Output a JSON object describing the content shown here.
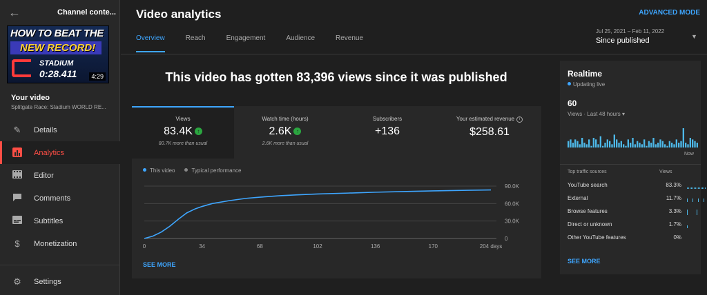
{
  "sidebar": {
    "title": "Channel conte...",
    "thumbnail": {
      "line1": "HOW TO BEAT THE",
      "line2": "NEW RECORD!",
      "line3": "STADIUM",
      "line4": "0:28.411",
      "duration": "4:29"
    },
    "your_video_label": "Your video",
    "video_title": "Splitgate Race: Stadium WORLD RE...",
    "nav": [
      {
        "label": "Details",
        "icon": "pencil-icon",
        "active": false
      },
      {
        "label": "Analytics",
        "icon": "analytics-icon",
        "active": true
      },
      {
        "label": "Editor",
        "icon": "film-icon",
        "active": false
      },
      {
        "label": "Comments",
        "icon": "comment-icon",
        "active": false
      },
      {
        "label": "Subtitles",
        "icon": "subtitles-icon",
        "active": false
      },
      {
        "label": "Monetization",
        "icon": "dollar-icon",
        "active": false
      }
    ],
    "settings_label": "Settings"
  },
  "header": {
    "title": "Video analytics",
    "advanced_mode": "ADVANCED MODE",
    "tabs": [
      "Overview",
      "Reach",
      "Engagement",
      "Audience",
      "Revenue"
    ],
    "active_tab": "Overview",
    "date_range": "Jul 25, 2021 – Feb 11, 2022",
    "period": "Since published"
  },
  "headline": "This video has gotten 83,396 views since it was published",
  "metrics": [
    {
      "label": "Views",
      "value": "83.4K",
      "up": true,
      "sub": "80.7K more than usual"
    },
    {
      "label": "Watch time (hours)",
      "value": "2.6K",
      "up": true,
      "sub": "2.6K more than usual"
    },
    {
      "label": "Subscribers",
      "value": "+136",
      "up": false,
      "sub": ""
    },
    {
      "label": "Your estimated revenue",
      "value": "$258.61",
      "up": false,
      "sub": ""
    }
  ],
  "chart_legend": {
    "this_video": "This video",
    "typical": "Typical performance"
  },
  "see_more": "SEE MORE",
  "colors": {
    "accent": "#3ea6ff",
    "active_nav": "#ff4e45",
    "up": "#2ba640"
  },
  "chart_data": {
    "type": "line",
    "x_ticks": [
      "0",
      "34",
      "68",
      "102",
      "136",
      "170",
      "204 days"
    ],
    "y_ticks": [
      "0",
      "30.0K",
      "60.0K",
      "90.0K"
    ],
    "ylim": [
      0,
      90000
    ],
    "xlim": [
      0,
      204
    ],
    "series": [
      {
        "name": "This video",
        "x": [
          0,
          5,
          10,
          15,
          20,
          25,
          30,
          34,
          40,
          50,
          60,
          68,
          80,
          90,
          102,
          120,
          136,
          150,
          170,
          190,
          204
        ],
        "values": [
          0,
          4000,
          11000,
          21000,
          33000,
          44000,
          51000,
          55000,
          60000,
          65000,
          69000,
          71000,
          73500,
          75000,
          76500,
          78000,
          79500,
          80500,
          81800,
          82800,
          83400
        ]
      }
    ]
  },
  "realtime": {
    "title": "Realtime",
    "status": "Updating live",
    "count": "60",
    "views_label": "Views · Last 48 hours",
    "now_label": "Now",
    "bars": [
      4,
      5,
      3,
      5,
      4,
      2,
      6,
      3,
      2,
      5,
      1,
      6,
      5,
      2,
      7,
      1,
      3,
      5,
      4,
      2,
      8,
      5,
      3,
      4,
      2,
      1,
      5,
      3,
      6,
      2,
      4,
      3,
      2,
      5,
      1,
      4,
      3,
      6,
      2,
      3,
      5,
      4,
      2,
      1,
      4,
      3,
      2,
      5,
      3,
      4,
      12,
      3,
      2,
      6,
      5,
      4,
      3
    ],
    "sources_header": "Top traffic sources",
    "views_header": "Views",
    "sources": [
      {
        "label": "YouTube search",
        "pct": "83.3%"
      },
      {
        "label": "External",
        "pct": "11.7%"
      },
      {
        "label": "Browse features",
        "pct": "3.3%"
      },
      {
        "label": "Direct or unknown",
        "pct": "1.7%"
      },
      {
        "label": "Other YouTube features",
        "pct": "0%"
      }
    ],
    "see_more": "SEE MORE"
  }
}
